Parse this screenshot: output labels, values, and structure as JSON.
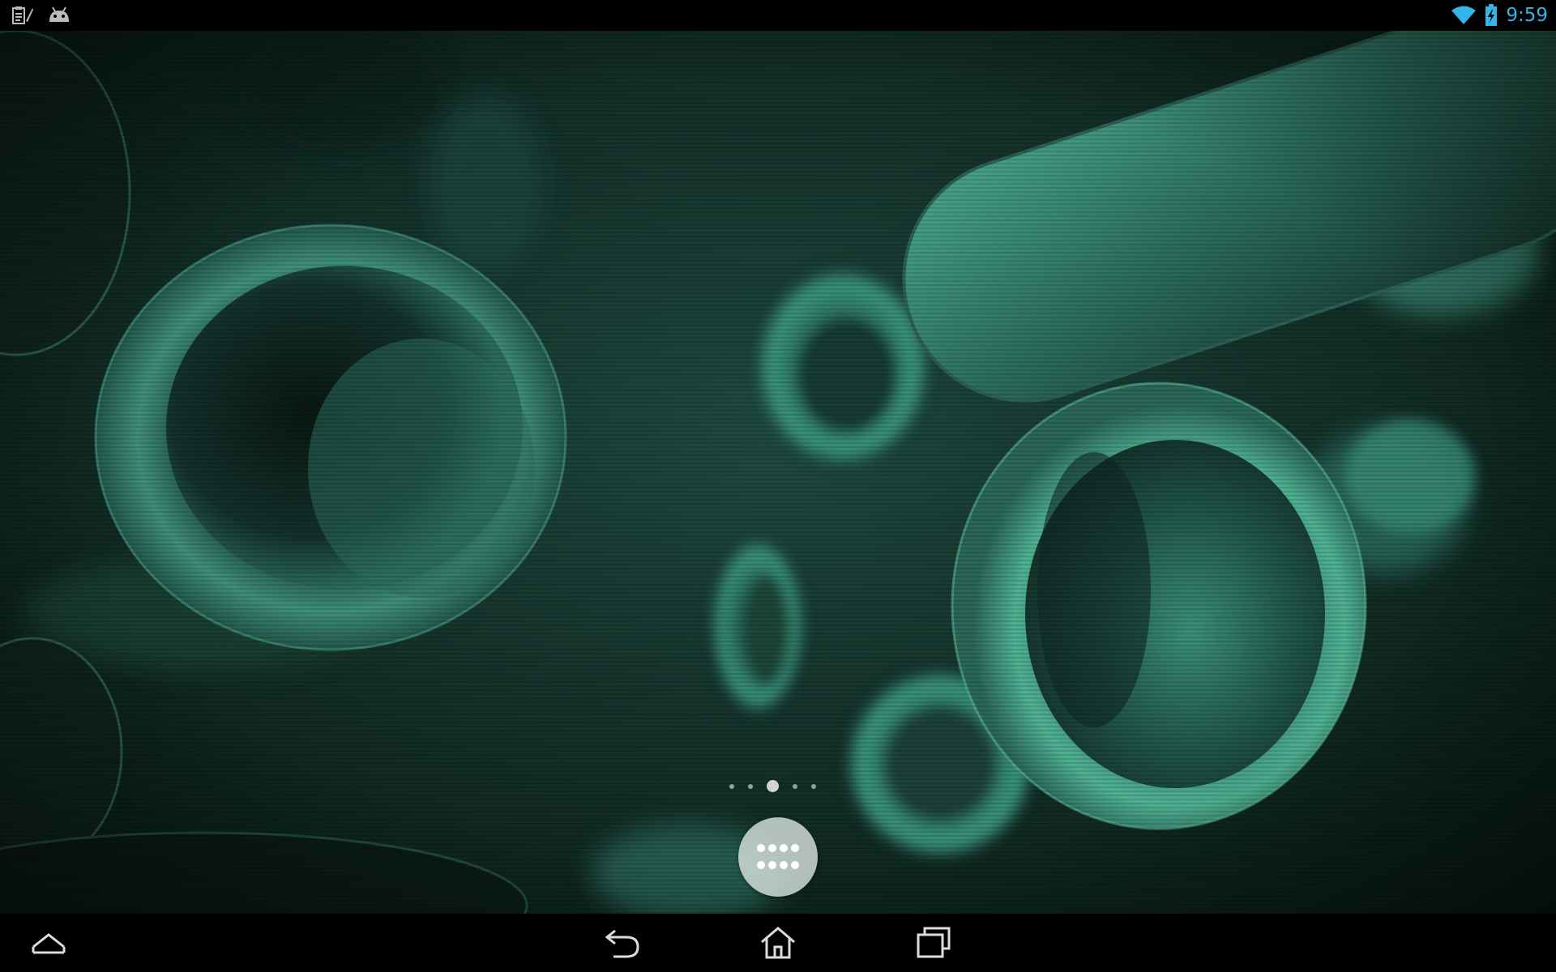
{
  "status_bar": {
    "time": "9:59",
    "left_icons": [
      "clipboard-notification-icon",
      "android-debug-icon"
    ],
    "right_icons": [
      "wifi-icon",
      "battery-charging-icon"
    ],
    "clock_color": "#33b5e5"
  },
  "wallpaper": {
    "description_icon": "blood-cells-live-wallpaper",
    "tint_color": "#3fa88a"
  },
  "home": {
    "page_count": 5,
    "active_page": 3,
    "all_apps_icon": "app-drawer-grid-icon"
  },
  "nav_bar": {
    "buttons": [
      "hide-keyboard-icon",
      "back-icon",
      "home-icon",
      "recent-apps-icon"
    ]
  }
}
